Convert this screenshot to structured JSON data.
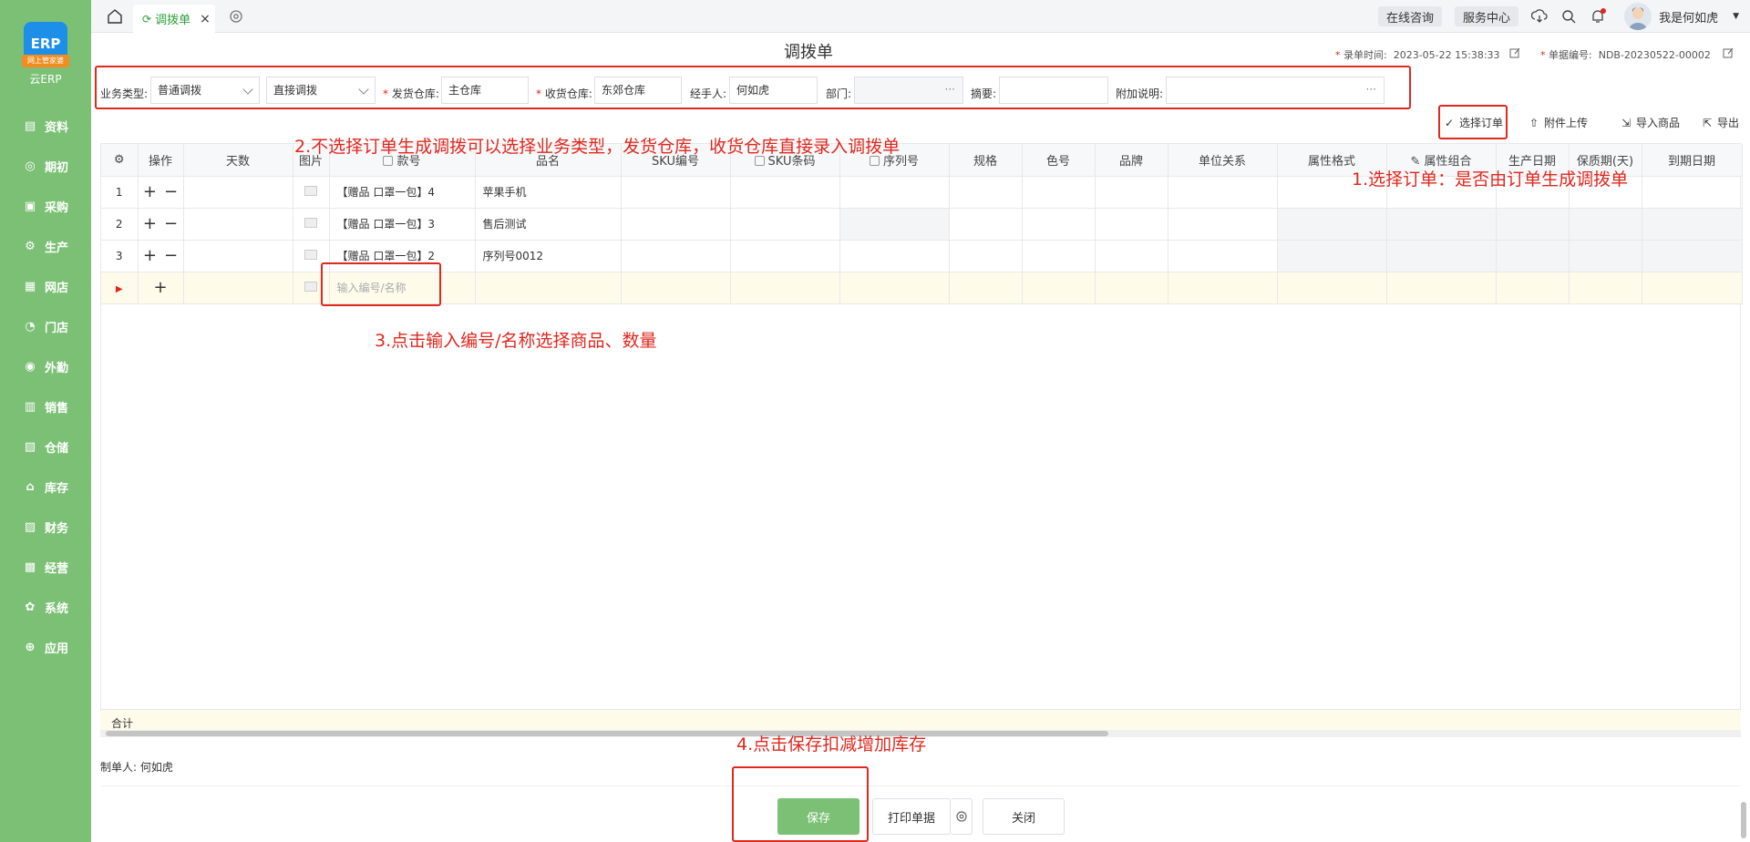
{
  "sidebar": {
    "logo_text": "ERP",
    "logo_badge": "网上管家婆",
    "app_name": "云ERP",
    "items": [
      {
        "label": "资料",
        "icon": "file-icon"
      },
      {
        "label": "期初",
        "icon": "target-icon"
      },
      {
        "label": "采购",
        "icon": "purchase-icon"
      },
      {
        "label": "生产",
        "icon": "production-icon"
      },
      {
        "label": "网店",
        "icon": "store-icon"
      },
      {
        "label": "门店",
        "icon": "pie-icon"
      },
      {
        "label": "外勤",
        "icon": "field-icon"
      },
      {
        "label": "销售",
        "icon": "sales-icon"
      },
      {
        "label": "仓储",
        "icon": "warehouse-icon"
      },
      {
        "label": "库存",
        "icon": "home-icon"
      },
      {
        "label": "财务",
        "icon": "finance-icon"
      },
      {
        "label": "经营",
        "icon": "operation-icon"
      },
      {
        "label": "系统",
        "icon": "gear-icon"
      },
      {
        "label": "应用",
        "icon": "plus-icon"
      }
    ]
  },
  "topbar": {
    "tab_label": "调拨单",
    "online_consult": "在线咨询",
    "service_center": "服务中心",
    "username": "我是何如虎"
  },
  "header": {
    "title": "调拨单",
    "record_time_label": "录单时间:",
    "record_time_value": "2023-05-22 15:38:33",
    "doc_no_label": "单据编号:",
    "doc_no_value": "NDB-20230522-00002"
  },
  "form": {
    "biz_type_label": "业务类型:",
    "biz_type_value": "普通调拨",
    "mode_value": "直接调拨",
    "ship_wh_label": "发货仓库:",
    "ship_wh_value": "主仓库",
    "recv_wh_label": "收货仓库:",
    "recv_wh_value": "东郊仓库",
    "handler_label": "经手人:",
    "handler_value": "何如虎",
    "dept_label": "部门:",
    "summary_label": "摘要:",
    "note_label": "附加说明:"
  },
  "toolbar": {
    "select_order": "选择订单",
    "attach_upload": "附件上传",
    "import_goods": "导入商品",
    "export": "导出"
  },
  "table": {
    "columns": [
      "操作",
      "天数",
      "图片",
      "款号",
      "品名",
      "SKU编号",
      "SKU条码",
      "序列号",
      "规格",
      "色号",
      "品牌",
      "单位关系",
      "属性格式",
      "属性组合",
      "生产日期",
      "保质期(天)",
      "到期日期"
    ],
    "rows": [
      {
        "no": "1",
        "code": "【赠品 口罩一包】4",
        "name": "苹果手机"
      },
      {
        "no": "2",
        "code": "【赠品 口罩一包】3",
        "name": "售后测试"
      },
      {
        "no": "3",
        "code": "【赠品 口罩一包】2",
        "name": "序列号0012"
      }
    ],
    "input_placeholder": "输入编号/名称",
    "sum_label": "合计"
  },
  "footer": {
    "creator_label": "制单人:",
    "creator_value": "何如虎",
    "save": "保存",
    "print": "打印单据",
    "close": "关闭"
  },
  "annotations": {
    "a1": "1.选择订单：是否由订单生成调拨单",
    "a2": "2.不选择订单生成调拨可以选择业务类型，发货仓库，收货仓库直接录入调拨单",
    "a3": "3.点击输入编号/名称选择商品、数量",
    "a4": "4.点击保存扣减增加库存"
  },
  "colors": {
    "sidebar": "#7cc076",
    "accent_green": "#2e9e3a",
    "annotation_red": "#e0281e"
  }
}
